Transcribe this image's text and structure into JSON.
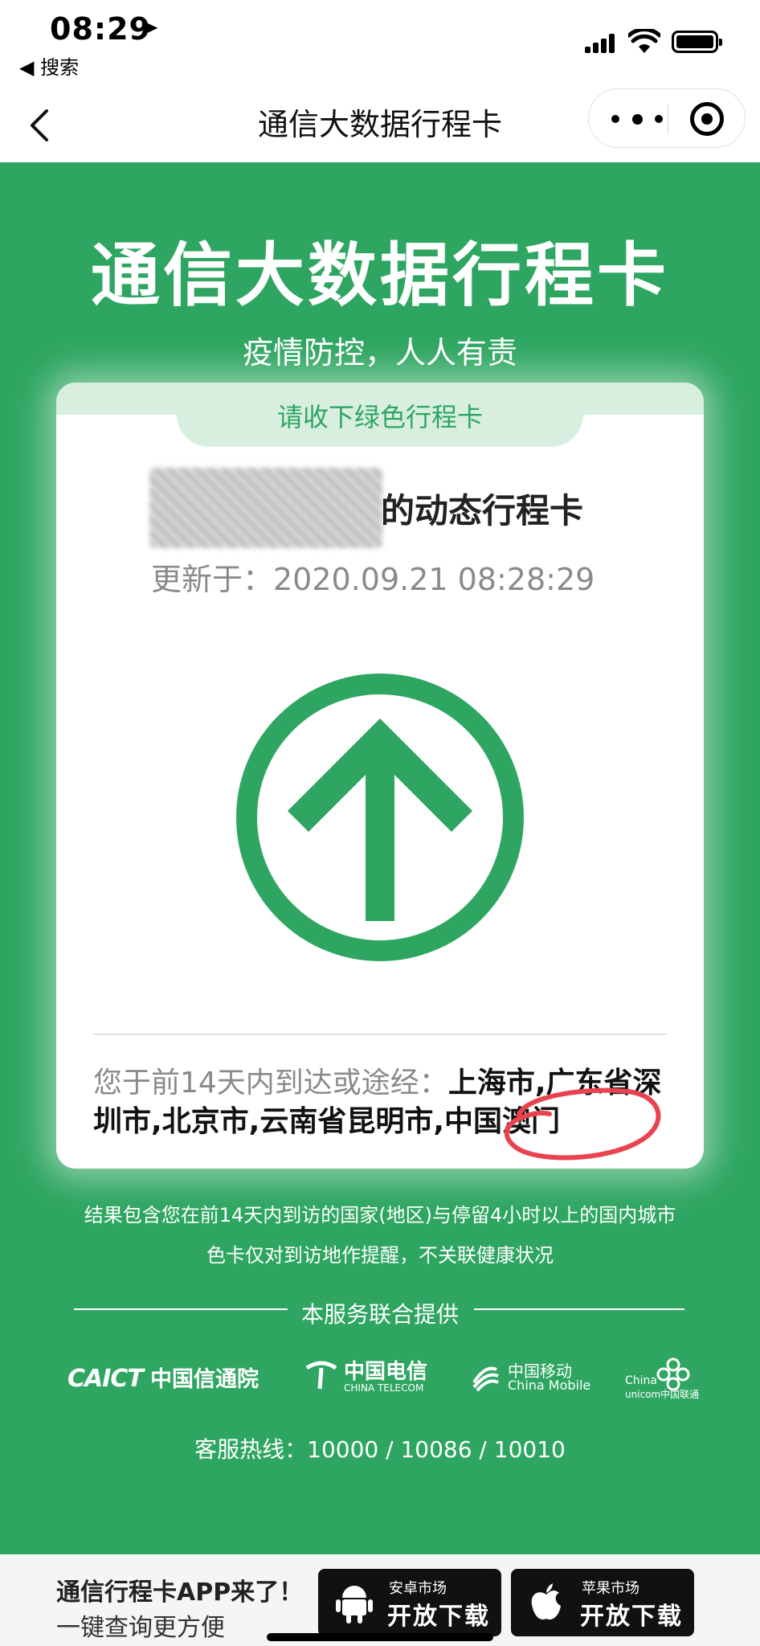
{
  "status_bar": {
    "time": "08:29",
    "back_app": "◀ 搜索"
  },
  "nav": {
    "title": "通信大数据行程卡"
  },
  "hero": {
    "title": "通信大数据行程卡",
    "subtitle": "疫情防控，人人有责"
  },
  "card": {
    "tab_label": "请收下绿色行程卡",
    "owner_suffix": "的动态行程卡",
    "updated": "更新于：2020.09.21 08:28:29",
    "badge_color": "#2ea661",
    "trip_lead": "您于前14天内到达或途经：",
    "trip_places": "上海市,广东省深圳市,北京市,云南省昆明市,中国澳门"
  },
  "notes": {
    "line1": "结果包含您在前14天内到访的国家(地区)与停留4小时以上的国内城市",
    "line2": "色卡仅对到访地作提醒，不关联健康状况"
  },
  "provider_label": "本服务联合提供",
  "logos": {
    "caict": "CAICT",
    "caict_cn": "中国信通院",
    "telecom_cn": "中国电信",
    "telecom_en": "CHINA TELECOM",
    "mobile_cn": "中国移动",
    "mobile_en": "China Mobile",
    "unicom_en1": "China",
    "unicom_en2": "unicom中国联通"
  },
  "hotline": "客服热线：10000 / 10086 / 10010",
  "banner": {
    "title": "通信行程卡APP来了！",
    "subtitle": "一键查询更方便",
    "android_store": "安卓市场",
    "android_action": "开放下载",
    "apple_store": "苹果市场",
    "apple_action": "开放下载"
  },
  "colors": {
    "brand_green": "#2ea661",
    "tab_bg": "#d8efe0",
    "annotation_red": "#e8434f"
  }
}
